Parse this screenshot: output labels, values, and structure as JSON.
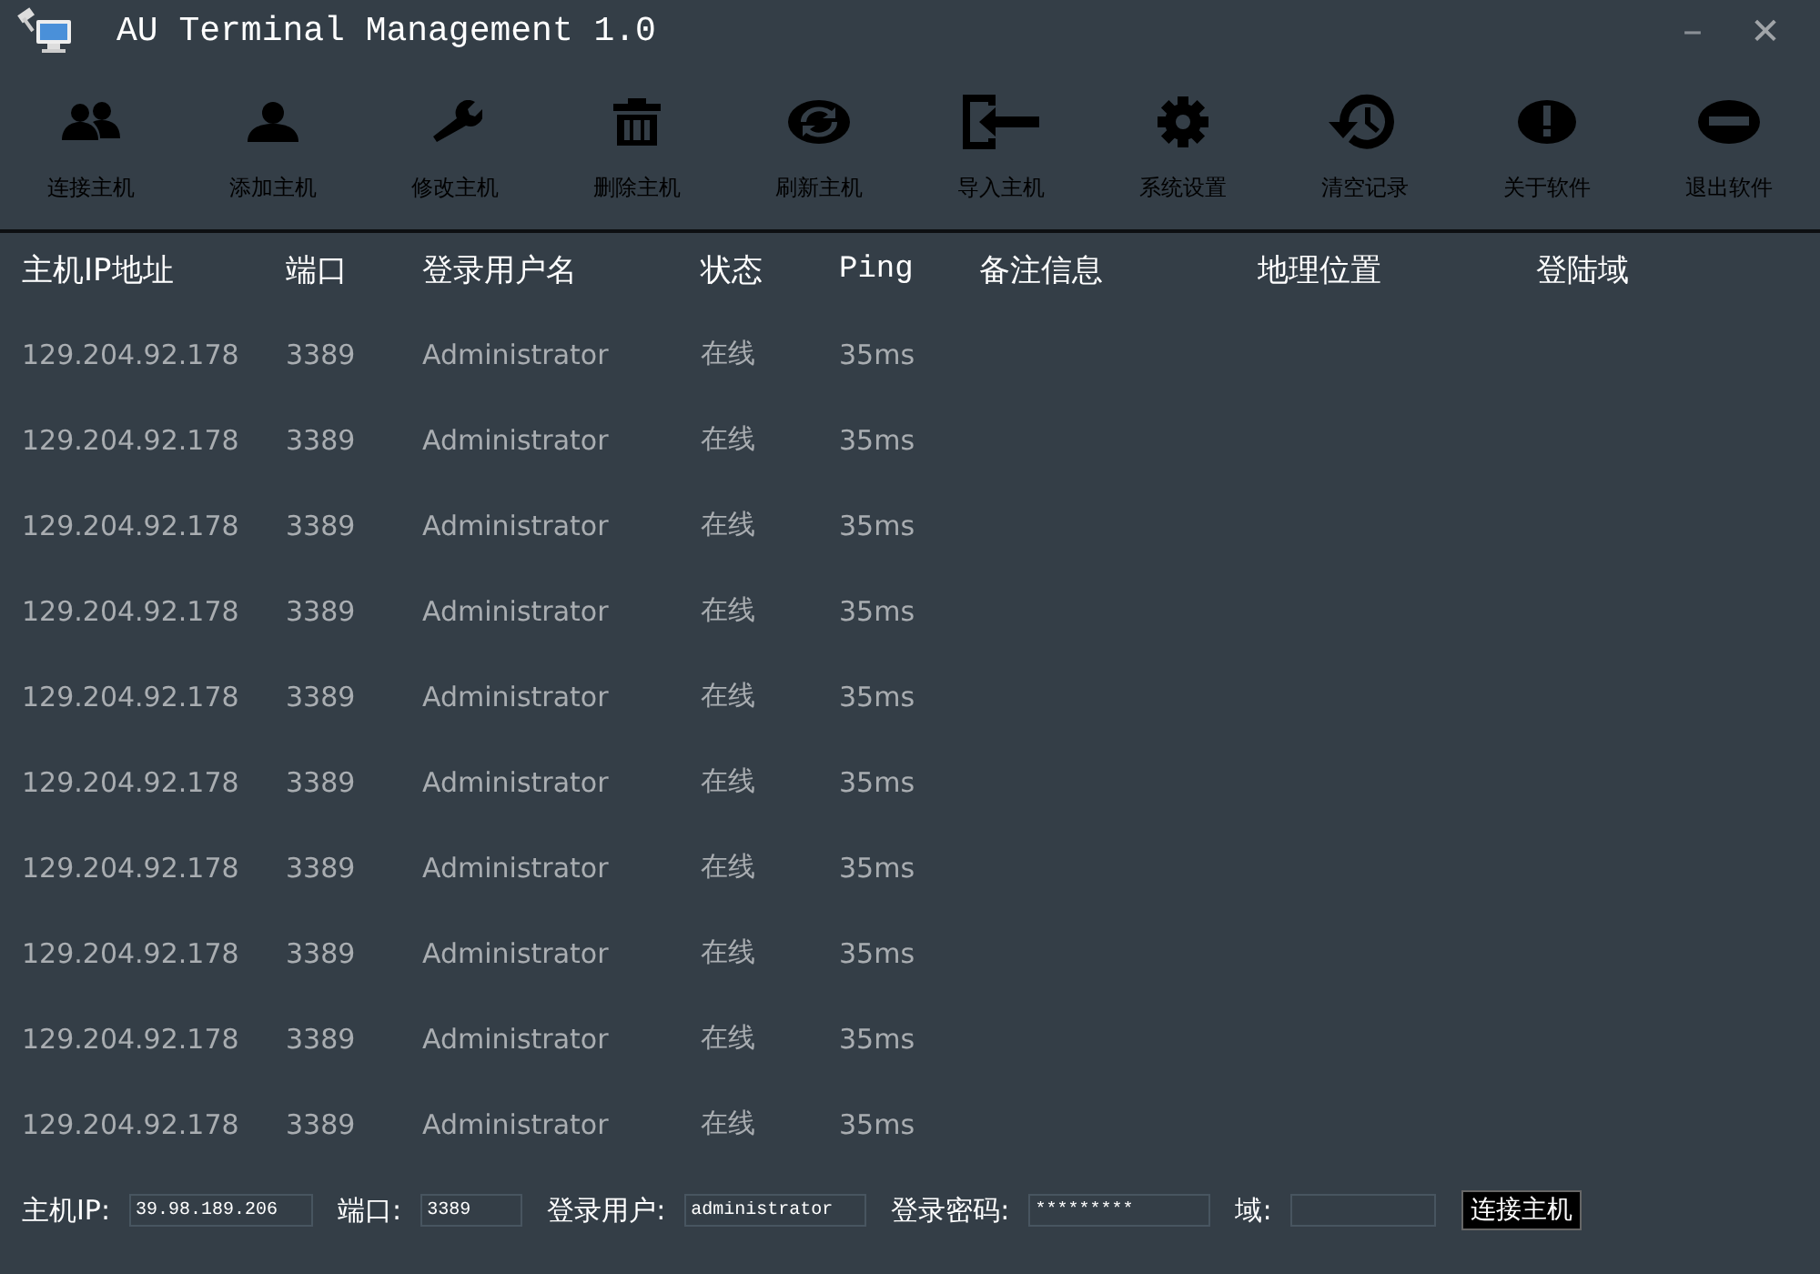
{
  "window": {
    "title": "AU Terminal Management 1.0",
    "controls": [
      {
        "kind": "minimize",
        "label": "–"
      },
      {
        "kind": "close",
        "label": "✕"
      }
    ]
  },
  "toolbar": [
    {
      "kind": "users",
      "label": "连接主机"
    },
    {
      "kind": "user",
      "label": "添加主机"
    },
    {
      "kind": "wrench",
      "label": "修改主机"
    },
    {
      "kind": "trash",
      "label": "删除主机"
    },
    {
      "kind": "refresh",
      "label": "刷新主机"
    },
    {
      "kind": "import",
      "label": "导入主机"
    },
    {
      "kind": "gear",
      "label": "系统设置"
    },
    {
      "kind": "history",
      "label": "清空记录"
    },
    {
      "kind": "exclamation",
      "label": "关于软件"
    },
    {
      "kind": "minus",
      "label": "退出软件"
    }
  ],
  "table": {
    "columns": [
      "主机IP地址",
      "端口",
      "登录用户名",
      "状态",
      "Ping",
      "备注信息",
      "地理位置",
      "登陆域"
    ],
    "rows": [
      [
        "129.204.92.178",
        "3389",
        "Administrator",
        "在线",
        "35ms"
      ],
      [
        "129.204.92.178",
        "3389",
        "Administrator",
        "在线",
        "35ms"
      ],
      [
        "129.204.92.178",
        "3389",
        "Administrator",
        "在线",
        "35ms"
      ],
      [
        "129.204.92.178",
        "3389",
        "Administrator",
        "在线",
        "35ms"
      ],
      [
        "129.204.92.178",
        "3389",
        "Administrator",
        "在线",
        "35ms"
      ],
      [
        "129.204.92.178",
        "3389",
        "Administrator",
        "在线",
        "35ms"
      ],
      [
        "129.204.92.178",
        "3389",
        "Administrator",
        "在线",
        "35ms"
      ],
      [
        "129.204.92.178",
        "3389",
        "Administrator",
        "在线",
        "35ms"
      ],
      [
        "129.204.92.178",
        "3389",
        "Administrator",
        "在线",
        "35ms"
      ],
      [
        "129.204.92.178",
        "3389",
        "Administrator",
        "在线",
        "35ms"
      ]
    ]
  },
  "connect_bar": {
    "fields": [
      {
        "label": "主机IP:",
        "value": "39.98.189.206"
      },
      {
        "label": "端口:",
        "value": "3389"
      },
      {
        "label": "登录用户:",
        "value": "administrator"
      },
      {
        "label": "登录密码:",
        "value": "*********"
      },
      {
        "label": "域:"
      }
    ],
    "button": "连接主机"
  }
}
